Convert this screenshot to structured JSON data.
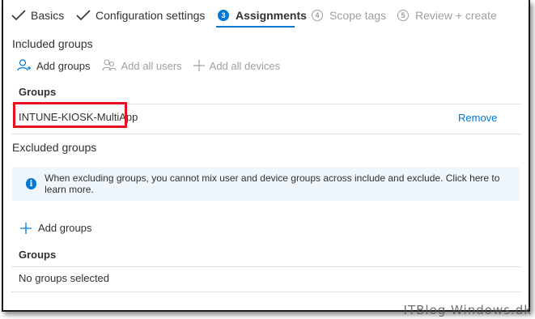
{
  "wizard": {
    "steps": [
      {
        "label": "Basics",
        "state": "done"
      },
      {
        "label": "Configuration settings",
        "state": "done"
      },
      {
        "number": "3",
        "label": "Assignments",
        "state": "active"
      },
      {
        "number": "4",
        "label": "Scope tags",
        "state": "disabled"
      },
      {
        "number": "5",
        "label": "Review + create",
        "state": "disabled"
      }
    ]
  },
  "included": {
    "title": "Included groups",
    "add_groups": "Add groups",
    "add_all_users": "Add all users",
    "add_all_devices": "Add all devices",
    "column_header": "Groups",
    "rows": [
      {
        "name": "INTUNE-KIOSK-MultiApp",
        "action": "Remove"
      }
    ]
  },
  "excluded": {
    "title": "Excluded groups",
    "info_message": "When excluding groups, you cannot mix user and device groups across include and exclude. Click here to learn more.",
    "add_groups": "Add groups",
    "column_header": "Groups",
    "empty_text": "No groups selected"
  },
  "watermark": "ITBlog Windows.dk",
  "colors": {
    "accent": "#0078d4",
    "highlight": "#e81123",
    "info_bg": "#eff6fc"
  }
}
